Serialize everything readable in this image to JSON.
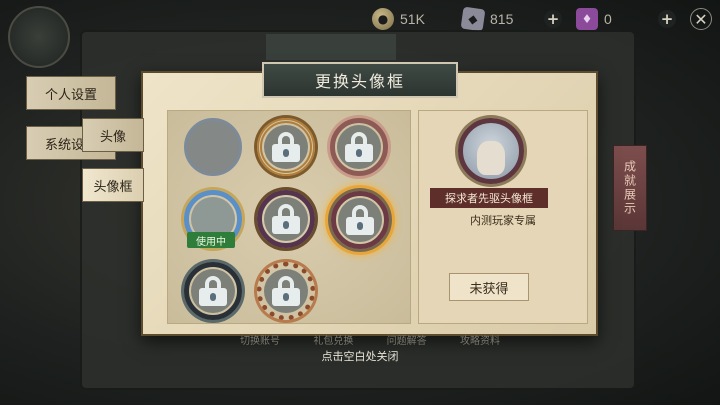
{
  "resources": {
    "coin_value": "51K",
    "gem_value": "815",
    "ticket_value": "0"
  },
  "side_tabs": {
    "personal": "个人设置",
    "system": "系统设置",
    "avatar": "头像",
    "frame": "头像框"
  },
  "modal": {
    "title": "更换头像框",
    "in_use_badge": "使用中"
  },
  "frames": [
    {
      "name": "empty",
      "locked": false
    },
    {
      "name": "gold-crown",
      "locked": true
    },
    {
      "name": "spiky-pink",
      "locked": true
    },
    {
      "name": "blue-wave",
      "locked": false,
      "in_use": true
    },
    {
      "name": "purple-vine",
      "locked": true
    },
    {
      "name": "ornament",
      "locked": true,
      "selected": true
    },
    {
      "name": "dark-tentacle",
      "locked": true
    },
    {
      "name": "sunburst",
      "locked": true
    }
  ],
  "detail": {
    "frame_name": "探求者先驱头像框",
    "description": "内测玩家专属",
    "status_button": "未获得"
  },
  "side_badge": "成就展示",
  "bottom_links": [
    "切换账号",
    "礼包兑换",
    "问题解答",
    "攻略资料"
  ],
  "close_hint": "点击空白处关闭"
}
